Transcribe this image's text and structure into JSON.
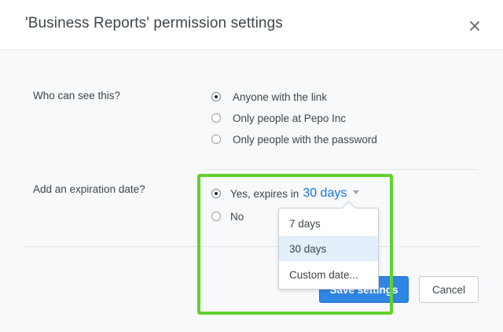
{
  "dialog": {
    "title": "'Business Reports' permission settings",
    "close_icon": "close-icon"
  },
  "visibility": {
    "label": "Who can see this?",
    "options": [
      {
        "label": "Anyone with the link",
        "checked": true
      },
      {
        "label": "Only people at Pepo Inc",
        "checked": false
      },
      {
        "label": "Only people with the password",
        "checked": false
      }
    ]
  },
  "expiration": {
    "label": "Add an expiration date?",
    "yes_label": "Yes, expires in",
    "yes_value": "30 days",
    "yes_checked": true,
    "no_label": "No",
    "no_checked": false,
    "dropdown_options": [
      {
        "label": "7 days",
        "selected": false
      },
      {
        "label": "30 days",
        "selected": true
      },
      {
        "label": "Custom date...",
        "selected": false
      }
    ]
  },
  "footer": {
    "save_label": "Save settings",
    "cancel_label": "Cancel"
  },
  "colors": {
    "accent": "#2f86e3",
    "link": "#1c73d9",
    "highlight": "#63d12e"
  }
}
